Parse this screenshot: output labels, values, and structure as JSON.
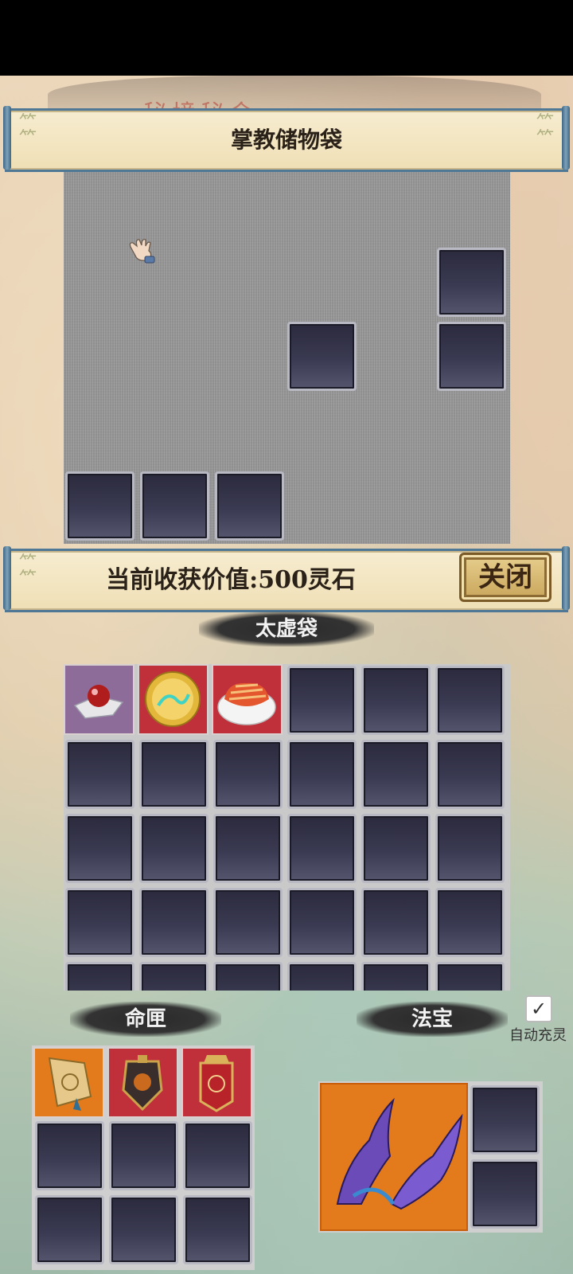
{
  "header": {
    "ghost_title": "秘境秘金",
    "title": "掌教储物袋"
  },
  "harvest": {
    "label": "当前收获价值:500灵石",
    "close_label": "关闭"
  },
  "sections": {
    "bag_label": "太虚袋",
    "fate_label": "命匣",
    "treasure_label": "法宝"
  },
  "auto_charge": {
    "checked": true,
    "check_glyph": "✓",
    "label": "自动充灵"
  },
  "bag_items": [
    {
      "name": "red-pearl-on-cloth-icon",
      "bg": "#8e6c9a"
    },
    {
      "name": "golden-dragon-orb-icon",
      "bg": "#c0303a"
    },
    {
      "name": "meat-bowl-icon",
      "bg": "#c0303a"
    }
  ],
  "fate_items": [
    {
      "name": "golden-talisman-plaque-icon",
      "bg": "#e37a1c"
    },
    {
      "name": "dark-orb-crest-icon",
      "bg": "#c0303a"
    },
    {
      "name": "red-command-token-icon",
      "bg": "#c0303a"
    }
  ],
  "treasure_item": {
    "name": "purple-wings-icon",
    "bg": "#e37a1c"
  },
  "colors": {
    "rarity_purple": "#8e6c9a",
    "rarity_red": "#c0303a",
    "rarity_orange": "#e37a1c",
    "banner_border": "#4f7896"
  }
}
